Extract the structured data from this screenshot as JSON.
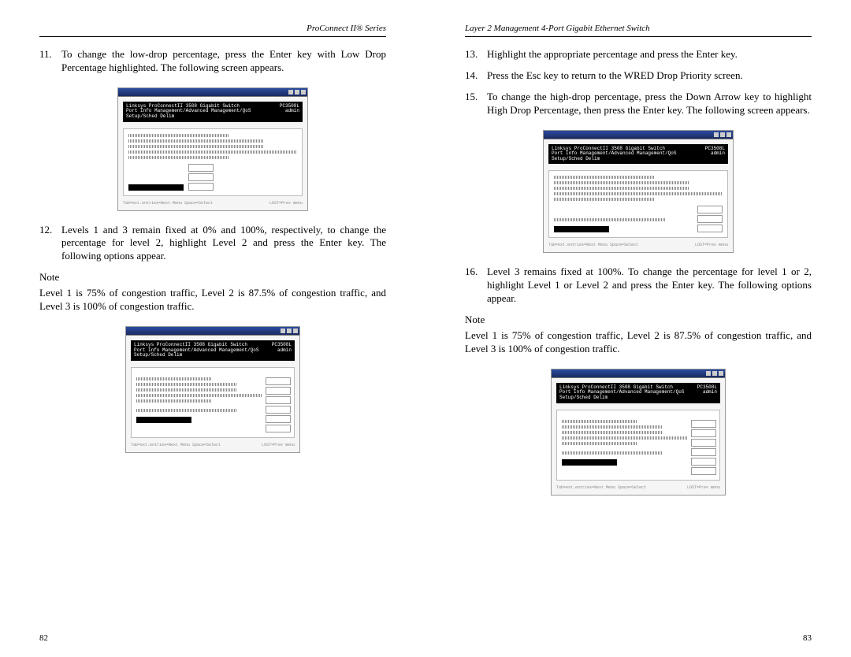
{
  "left": {
    "header": "ProConnect II® Series",
    "steps": [
      {
        "num": "11.",
        "text": "To change the low-drop percentage, press the Enter key with Low Drop Percentage highlighted. The following screen appears."
      },
      {
        "num": "12.",
        "text": "Levels 1 and 3 remain fixed at 0% and 100%, respectively, to change the percentage for level 2, highlight Level 2 and press the Enter key. The following options appear."
      }
    ],
    "note_label": "Note",
    "note_body": "Level 1 is 75% of congestion traffic, Level 2 is 87.5% of congestion traffic, and Level 3 is 100% of congestion traffic.",
    "page_num": "82"
  },
  "right": {
    "header": "Layer 2 Management 4-Port Gigabit Ethernet Switch",
    "steps": [
      {
        "num": "13.",
        "text": "Highlight the appropriate percentage and press the Enter key."
      },
      {
        "num": "14.",
        "text": "Press the Esc key to return to the WRED Drop Priority screen."
      },
      {
        "num": "15.",
        "text": "To change the high-drop percentage, press the Down Arrow key to highlight High Drop Percentage, then press the Enter key. The following screen appears."
      },
      {
        "num": "16.",
        "text": "Level 3 remains fixed at 100%. To change the percentage for level 1 or 2, highlight Level 1 or Level 2 and press the Enter key. The following options appear."
      }
    ],
    "note_label": "Note",
    "note_body": "Level 1 is 75% of congestion traffic, Level 2 is 87.5% of congestion traffic, and Level 3 is 100% of congestion traffic.",
    "page_num": "83"
  },
  "mock": {
    "bar_left": "Linksys ProConnectII 3508 Gigabit Switch\nPort Info Management/Advanced Management/QoS Setup/Sched Delim",
    "bar_right": "PC3508L\nadmin",
    "footer_left": "Tab=ext.entries=Next Menu  Space=Select",
    "footer_right": "LOST=Prev menu"
  }
}
